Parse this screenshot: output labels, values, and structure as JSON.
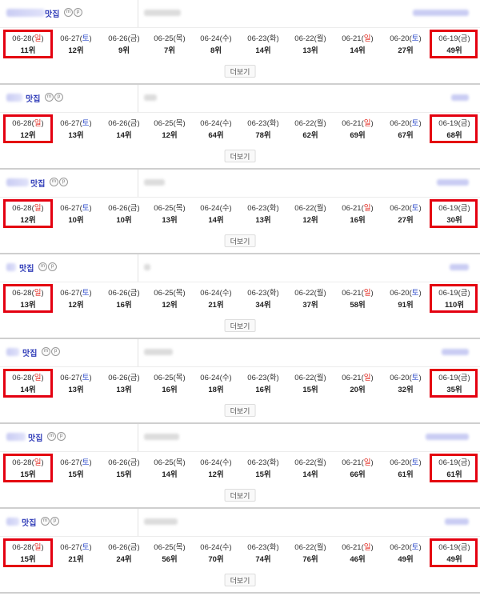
{
  "colors": {
    "highlight": "#e40010",
    "saturday": "#2a48c9",
    "sunday": "#e1251b",
    "title": "#2f3bb8"
  },
  "dates": [
    {
      "d": "06-28",
      "w": "일",
      "t": "sun"
    },
    {
      "d": "06-27",
      "w": "토",
      "t": "sat"
    },
    {
      "d": "06-26",
      "w": "금",
      "t": ""
    },
    {
      "d": "06-25",
      "w": "목",
      "t": ""
    },
    {
      "d": "06-24",
      "w": "수",
      "t": ""
    },
    {
      "d": "06-23",
      "w": "화",
      "t": ""
    },
    {
      "d": "06-22",
      "w": "월",
      "t": ""
    },
    {
      "d": "06-21",
      "w": "일",
      "t": "sun"
    },
    {
      "d": "06-20",
      "w": "토",
      "t": "sat"
    },
    {
      "d": "06-19",
      "w": "금",
      "t": ""
    }
  ],
  "rank_suffix": "위",
  "more_label": "더보기",
  "badge_labels": [
    "m",
    "p"
  ],
  "watermark": "타인마",
  "cards": [
    {
      "title": "맛집",
      "ranks": [
        11,
        12,
        9,
        7,
        8,
        14,
        13,
        14,
        27,
        49
      ]
    },
    {
      "title": "맛집",
      "ranks": [
        12,
        13,
        14,
        12,
        64,
        78,
        62,
        69,
        67,
        68
      ]
    },
    {
      "title": "맛집",
      "ranks": [
        12,
        10,
        10,
        13,
        14,
        13,
        12,
        16,
        27,
        30
      ]
    },
    {
      "title": "맛집",
      "ranks": [
        13,
        12,
        16,
        12,
        21,
        34,
        37,
        58,
        91,
        110
      ]
    },
    {
      "title": "맛집",
      "ranks": [
        14,
        13,
        13,
        16,
        18,
        16,
        15,
        20,
        32,
        35
      ]
    },
    {
      "title": "맛집",
      "ranks": [
        15,
        15,
        15,
        14,
        12,
        15,
        14,
        66,
        61,
        61
      ]
    },
    {
      "title": "맛집",
      "ranks": [
        15,
        21,
        24,
        56,
        70,
        74,
        76,
        46,
        49,
        49
      ]
    }
  ]
}
